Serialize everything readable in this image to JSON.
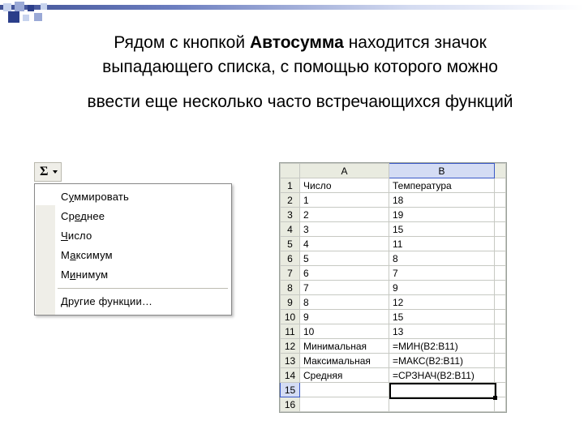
{
  "text": {
    "line1_pre": "Рядом с кнопкой ",
    "line1_bold": "Автосумма",
    "line1_post": " находится значок",
    "line2": "выпадающего списка, с помощью которого можно",
    "line3": "ввести еще несколько часто встречающихся функций"
  },
  "sigma": "Σ",
  "menu": {
    "items": [
      {
        "pre": "С",
        "u": "у",
        "post": "ммировать"
      },
      {
        "pre": "Ср",
        "u": "е",
        "post": "днее"
      },
      {
        "pre": "",
        "u": "Ч",
        "post": "исло"
      },
      {
        "pre": "М",
        "u": "а",
        "post": "ксимум"
      },
      {
        "pre": "М",
        "u": "и",
        "post": "нимум"
      }
    ],
    "other": {
      "pre": "",
      "u": "Д",
      "post": "ругие функции…"
    }
  },
  "sheet": {
    "colA": "A",
    "colB": "B",
    "rows": [
      {
        "n": "1",
        "a": "Число",
        "b": "Температура"
      },
      {
        "n": "2",
        "a": "1",
        "b": "18"
      },
      {
        "n": "3",
        "a": "2",
        "b": "19"
      },
      {
        "n": "4",
        "a": "3",
        "b": "15"
      },
      {
        "n": "5",
        "a": "4",
        "b": "11"
      },
      {
        "n": "6",
        "a": "5",
        "b": "8"
      },
      {
        "n": "7",
        "a": "6",
        "b": "7"
      },
      {
        "n": "8",
        "a": "7",
        "b": "9"
      },
      {
        "n": "9",
        "a": "8",
        "b": "12"
      },
      {
        "n": "10",
        "a": "9",
        "b": "15"
      },
      {
        "n": "11",
        "a": "10",
        "b": "13"
      },
      {
        "n": "12",
        "a": "Минимальная",
        "b": "=МИН(B2:B11)"
      },
      {
        "n": "13",
        "a": "Максимальная",
        "b": "=МАКС(B2:B11)"
      },
      {
        "n": "14",
        "a": "Средняя",
        "b": "=СРЗНАЧ(B2:B11)"
      },
      {
        "n": "15",
        "a": "",
        "b": ""
      },
      {
        "n": "16",
        "a": "",
        "b": ""
      }
    ]
  }
}
